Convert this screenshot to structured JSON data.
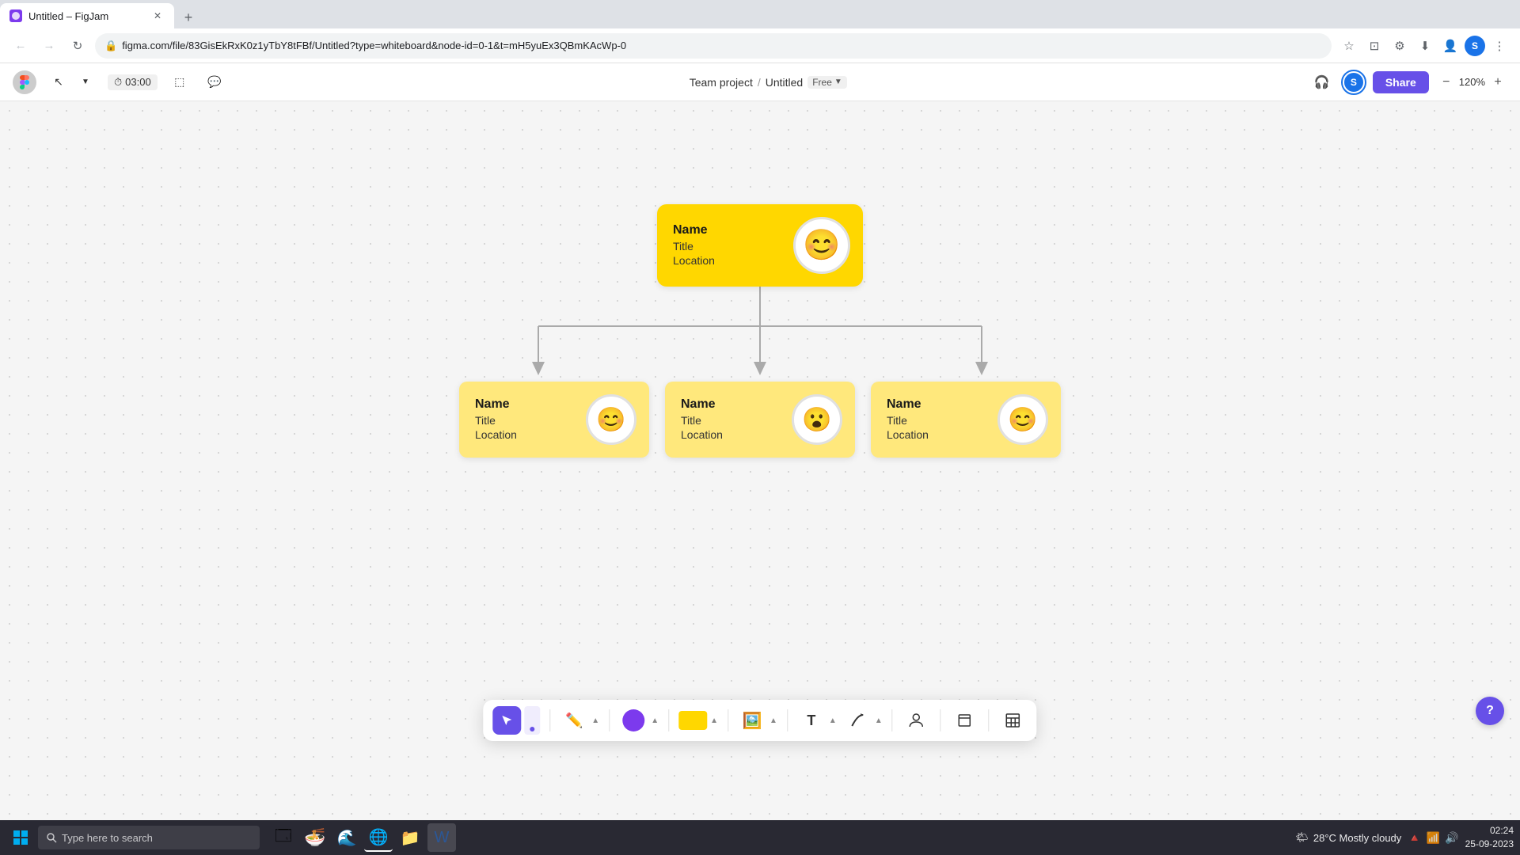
{
  "browser": {
    "tab_title": "Untitled – FigJam",
    "url": "figma.com/file/83GisEkRxK0z1yTbY8tFBf/Untitled?type=whiteboard&node-id=0-1&t=mH5yuEx3QBmKAcWp-0",
    "url_display": "figma.com/file/83GisEkRxK0z1yTbY8tFBf/Untitled?type=whiteboard&node-id=0-1&t=mH5yuEx3QBmKAcWp-0"
  },
  "figma": {
    "timer": "03:00",
    "project": "Team project",
    "file_name": "Untitled",
    "plan": "Free",
    "share_label": "Share",
    "zoom": "120%"
  },
  "org_chart": {
    "root": {
      "name": "Name",
      "title": "Title",
      "location": "Location",
      "face": "😊"
    },
    "children": [
      {
        "name": "Name",
        "title": "Title",
        "location": "Location",
        "face": "😊"
      },
      {
        "name": "Name",
        "title": "Title",
        "location": "Location",
        "face": "😮"
      },
      {
        "name": "Name",
        "title": "Title",
        "location": "Location",
        "face": "😊"
      }
    ]
  },
  "toolbar": {
    "move_label": "Move",
    "pen_label": "Pen",
    "shapes_label": "Shapes",
    "text_label": "T",
    "connector_label": "Connector",
    "person_label": "Person",
    "frame_label": "Frame",
    "table_label": "Table"
  },
  "taskbar": {
    "search_placeholder": "Type here to search",
    "time": "02:24",
    "date": "25-09-2023",
    "temperature": "28°C  Mostly cloudy"
  }
}
